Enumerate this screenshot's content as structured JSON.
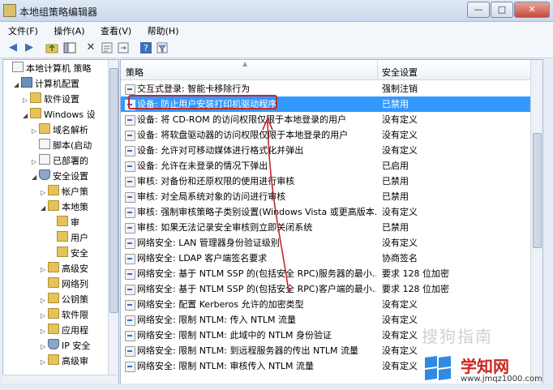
{
  "window": {
    "title": "本地组策略编辑器",
    "buttons": [
      "—",
      "□",
      "✕"
    ]
  },
  "menu": [
    "文件(F)",
    "操作(A)",
    "查看(V)",
    "帮助(H)"
  ],
  "tree": [
    {
      "label": "本地计算机 策略",
      "level": 0,
      "icon": "doc-icon",
      "twisty": ""
    },
    {
      "label": "计算机配置",
      "level": 1,
      "icon": "computer-icon",
      "twisty": "◢"
    },
    {
      "label": "软件设置",
      "level": 2,
      "icon": "folder-icon",
      "twisty": "▷"
    },
    {
      "label": "Windows 设",
      "level": 2,
      "icon": "folder-icon",
      "twisty": "◢"
    },
    {
      "label": "域名解析",
      "level": 3,
      "icon": "folder-icon",
      "twisty": "▷"
    },
    {
      "label": "脚本(启动",
      "level": 3,
      "icon": "doc-icon",
      "twisty": ""
    },
    {
      "label": "已部署的",
      "level": 3,
      "icon": "printer-icon",
      "twisty": "▷"
    },
    {
      "label": "安全设置",
      "level": 3,
      "icon": "shield-icon",
      "twisty": "◢"
    },
    {
      "label": "帐户策",
      "level": 4,
      "icon": "folder-icon",
      "twisty": "▷"
    },
    {
      "label": "本地策",
      "level": 4,
      "icon": "folder-icon",
      "twisty": "◢"
    },
    {
      "label": "审",
      "level": 5,
      "icon": "lock-folder-icon",
      "twisty": ""
    },
    {
      "label": "用户",
      "level": 5,
      "icon": "lock-folder-icon",
      "twisty": ""
    },
    {
      "label": "安全",
      "level": 5,
      "icon": "lock-folder-icon",
      "twisty": ""
    },
    {
      "label": "高级安",
      "level": 4,
      "icon": "folder-icon",
      "twisty": "▷"
    },
    {
      "label": "网络列",
      "level": 4,
      "icon": "folder-icon",
      "twisty": ""
    },
    {
      "label": "公钥策",
      "level": 4,
      "icon": "folder-icon",
      "twisty": "▷"
    },
    {
      "label": "软件限",
      "level": 4,
      "icon": "folder-icon",
      "twisty": "▷"
    },
    {
      "label": "应用程",
      "level": 4,
      "icon": "folder-icon",
      "twisty": "▷"
    },
    {
      "label": "IP 安全",
      "level": 4,
      "icon": "shield-icon",
      "twisty": "▷"
    },
    {
      "label": "高级审",
      "level": 4,
      "icon": "folder-icon",
      "twisty": "▷"
    }
  ],
  "list": {
    "col_policy": "策略",
    "col_setting": "安全设置",
    "selected_index": 1,
    "rows": [
      {
        "policy": "交互式登录: 智能卡移除行为",
        "setting": "强制注销"
      },
      {
        "policy": "设备: 防止用户安装打印机驱动程序",
        "setting": "已禁用"
      },
      {
        "policy": "设备: 将 CD-ROM 的访问权限仅限于本地登录的用户",
        "setting": "没有定义"
      },
      {
        "policy": "设备: 将软盘驱动器的访问权限仅限于本地登录的用户",
        "setting": "没有定义"
      },
      {
        "policy": "设备: 允许对可移动媒体进行格式化并弹出",
        "setting": "没有定义"
      },
      {
        "policy": "设备: 允许在未登录的情况下弹出",
        "setting": "已启用"
      },
      {
        "policy": "审核: 对备份和还原权限的使用进行审核",
        "setting": "已禁用"
      },
      {
        "policy": "审核: 对全局系统对象的访问进行审核",
        "setting": "已禁用"
      },
      {
        "policy": "审核: 强制审核策略子类别设置(Windows Vista 或更高版本...",
        "setting": "没有定义"
      },
      {
        "policy": "审核: 如果无法记录安全审核则立即关闭系统",
        "setting": "已禁用"
      },
      {
        "policy": "网络安全: LAN 管理器身份验证级别",
        "setting": "没有定义"
      },
      {
        "policy": "网络安全: LDAP 客户端签名要求",
        "setting": "协商签名"
      },
      {
        "policy": "网络安全: 基于 NTLM SSP 的(包括安全 RPC)服务器的最小...",
        "setting": "要求 128 位加密"
      },
      {
        "policy": "网络安全: 基于 NTLM SSP 的(包括安全 RPC)客户端的最小...",
        "setting": "要求 128 位加密"
      },
      {
        "policy": "网络安全: 配置 Kerberos 允许的加密类型",
        "setting": "没有定义"
      },
      {
        "policy": "网络安全: 限制 NTLM: 传入 NTLM 流量",
        "setting": "没有定义"
      },
      {
        "policy": "网络安全: 限制 NTLM: 此域中的 NTLM 身份验证",
        "setting": "没有定义"
      },
      {
        "policy": "网络安全: 限制 NTLM: 到远程服务器的传出 NTLM 流量",
        "setting": "没有定义"
      },
      {
        "policy": "网络安全: 限制 NTLM: 审核传入 NTLM 流量",
        "setting": "没有定义"
      }
    ]
  },
  "watermark": {
    "text": "搜狗指南",
    "site": "学知网",
    "url": "www.jmqz1000.com"
  },
  "colors": {
    "selection": "#3399ff",
    "annotation": "#c4262e"
  }
}
